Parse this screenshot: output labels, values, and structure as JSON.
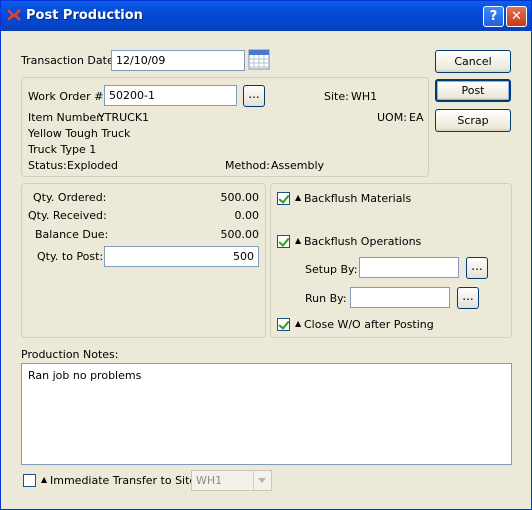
{
  "window": {
    "title": "Post Production",
    "help_glyph": "?",
    "close_glyph": "✕"
  },
  "header": {
    "transaction_date_label": "Transaction Date:",
    "transaction_date_value": "12/10/09"
  },
  "actions": {
    "cancel": "Cancel",
    "post": "Post",
    "scrap": "Scrap"
  },
  "work_order": {
    "label": "Work Order #:",
    "value": "50200-1",
    "lookup": "...",
    "site_label": "Site:",
    "site_value": "WH1",
    "item_number_label": "Item Number:",
    "item_number_value": "YTRUCK1",
    "uom_label": "UOM:",
    "uom_value": "EA",
    "description1": "Yellow Tough Truck",
    "description2": "Truck Type 1",
    "status_label": "Status:",
    "status_value": "Exploded",
    "method_label": "Method:",
    "method_value": "Assembly"
  },
  "quantities": {
    "ordered_label": "Qty. Ordered:",
    "ordered_value": "500.00",
    "received_label": "Qty. Received:",
    "received_value": "0.00",
    "balance_label": "Balance Due:",
    "balance_value": "500.00",
    "to_post_label": "Qty. to Post:",
    "to_post_value": "500"
  },
  "options": {
    "backflush_materials": {
      "label": "Backflush Materials",
      "checked": true
    },
    "backflush_operations": {
      "label": "Backflush Operations",
      "checked": true
    },
    "setup_by_label": "Setup By:",
    "setup_by_value": "",
    "run_by_label": "Run By:",
    "run_by_value": "",
    "lookup": "...",
    "close_wo": {
      "label": "Close W/O after Posting",
      "checked": true
    }
  },
  "notes": {
    "label": "Production Notes:",
    "value": "Ran job no problems"
  },
  "transfer": {
    "label": "Immediate Transfer to Site:",
    "checked": false,
    "site_value": "WH1"
  },
  "colors": {
    "titlebar": "#0a5fe8",
    "face": "#ece9d8",
    "check": "#21a121"
  }
}
